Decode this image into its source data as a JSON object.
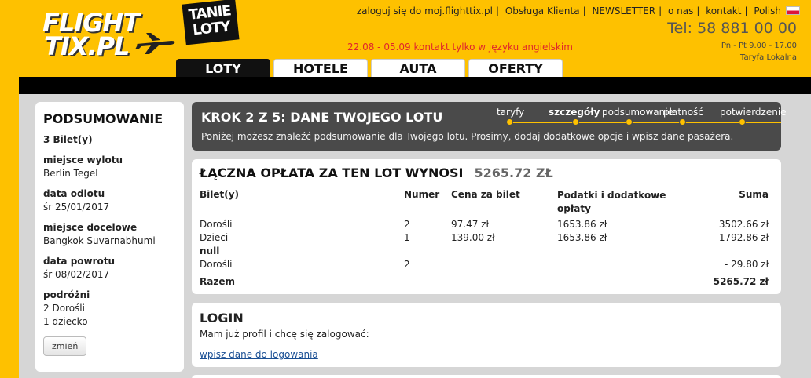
{
  "logo": {
    "line1": "FLIGHT",
    "line2": "TIX.PL",
    "badge": "TANIE LOTY"
  },
  "toplinks": [
    "zaloguj się do moj.flighttix.pl",
    "Obsługa Klienta",
    "NEWSLETTER",
    "o nas",
    "kontakt",
    "Polish"
  ],
  "notice": "22.08 - 05.09 kontakt tylko w języku angielskim",
  "phone": "Tel: 58 881 00 00",
  "hours": "Pn - Pt 9.00 - 17.00",
  "tariff": "Taryfa Lokalna",
  "tabs": [
    "LOTY",
    "HOTELE",
    "AUTA",
    "OFERTY"
  ],
  "sidebar": {
    "title": "PODSUMOWANIE",
    "count": "3 Bilet(y)",
    "departure_label": "miejsce wylotu",
    "departure": "Berlin Tegel",
    "depart_date_label": "data odlotu",
    "depart_date": "śr 25/01/2017",
    "destination_label": "miejsce docelowe",
    "destination": "Bangkok Suvarnabhumi",
    "return_label": "data powrotu",
    "return_date": "śr 08/02/2017",
    "travelers_label": "podróżni",
    "adults": "2 Dorośli",
    "children": "1 dziecko",
    "change_button": "zmień"
  },
  "step": {
    "title": "KROK 2 Z 5: DANE TWOJEGO LOTU",
    "description": "Poniżej możesz znaleźć podsumowanie dla Twojego lotu. Prosimy, dodaj dodatkowe opcje i wpisz dane pasażera.",
    "steps": [
      "taryfy",
      "szczegóły",
      "podsumowanie",
      "płatność",
      "potwierdzenie"
    ]
  },
  "price": {
    "title": "ŁĄCZNA OPŁATA ZA TEN LOT WYNOSI",
    "total": "5265.72 ZŁ",
    "headers": [
      "Bilet(y)",
      "Numer",
      "Cena za bilet",
      "Podatki i dodatkowe opłaty",
      "Suma"
    ],
    "rows": [
      [
        "Dorośli",
        "2",
        "97.47 zł",
        "1653.86 zł",
        "3502.66 zł"
      ],
      [
        "Dzieci",
        "1",
        "139.00 zł",
        "1653.86 zł",
        "1792.86 zł"
      ],
      [
        "null",
        "",
        "",
        "",
        ""
      ],
      [
        "Dorośli",
        "2",
        "",
        "",
        "- 29.80 zł"
      ]
    ],
    "sum_label": "Razem",
    "sum_value": "5265.72 zł"
  },
  "login": {
    "title": "LOGIN",
    "prompt": "Mam już profil i chcę się zalogować:",
    "link": "wpisz dane do logowania"
  },
  "colors": {
    "brand": "#fec100",
    "dark": "#4a4a4a",
    "link": "#1a4f94",
    "notice": "#e0262b"
  }
}
